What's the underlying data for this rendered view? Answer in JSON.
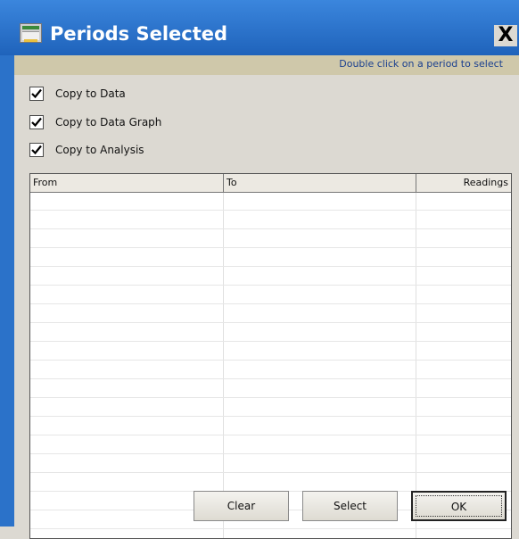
{
  "window": {
    "title": "Periods Selected",
    "close_label": "X"
  },
  "hint": "Double click on a period to select",
  "options": [
    {
      "label": "Copy to Data",
      "checked": true
    },
    {
      "label": "Copy to Data Graph",
      "checked": true
    },
    {
      "label": "Copy to Analysis",
      "checked": true
    }
  ],
  "table": {
    "columns": [
      "From",
      "To",
      "Readings"
    ],
    "rows": []
  },
  "buttons": {
    "clear": "Clear",
    "select": "Select",
    "ok": "OK"
  },
  "colors": {
    "titlebar": "#2b72c9",
    "dialog_bg": "#dcd9d2",
    "hint_bar": "#cfc8aa",
    "hint_text": "#1a3f8f"
  }
}
